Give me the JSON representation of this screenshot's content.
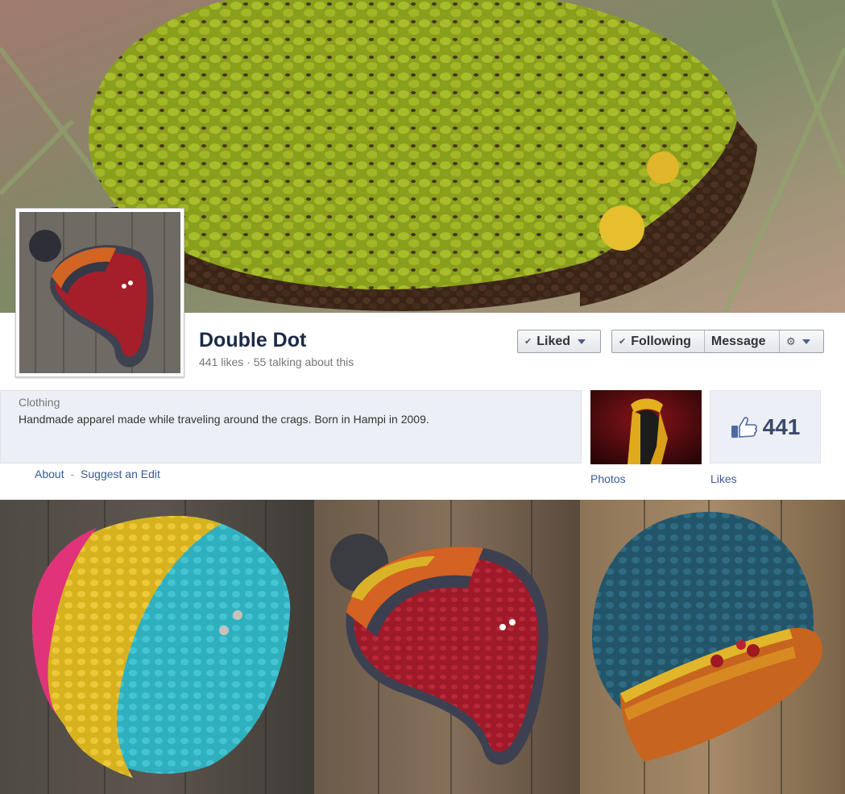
{
  "page": {
    "name": "Double Dot",
    "likes_text": "441 likes",
    "talking_text": "55 talking about this",
    "separator": "·",
    "category": "Clothing",
    "description": "Handmade apparel made while traveling around the crags. Born in Hampi in 2009."
  },
  "actions": {
    "liked_label": "Liked",
    "following_label": "Following",
    "message_label": "Message"
  },
  "links": {
    "about_label": "About",
    "separator": "-",
    "suggest_label": "Suggest an Edit"
  },
  "apps": {
    "photos_label": "Photos",
    "likes_label": "Likes",
    "likes_count": "441"
  },
  "icons": [
    "check-icon",
    "chevron-down-icon",
    "gear-icon",
    "thumbs-up-icon"
  ],
  "colors": {
    "link": "#3b5998",
    "page_name": "#1c2a47",
    "info_background": "#eceff5"
  }
}
